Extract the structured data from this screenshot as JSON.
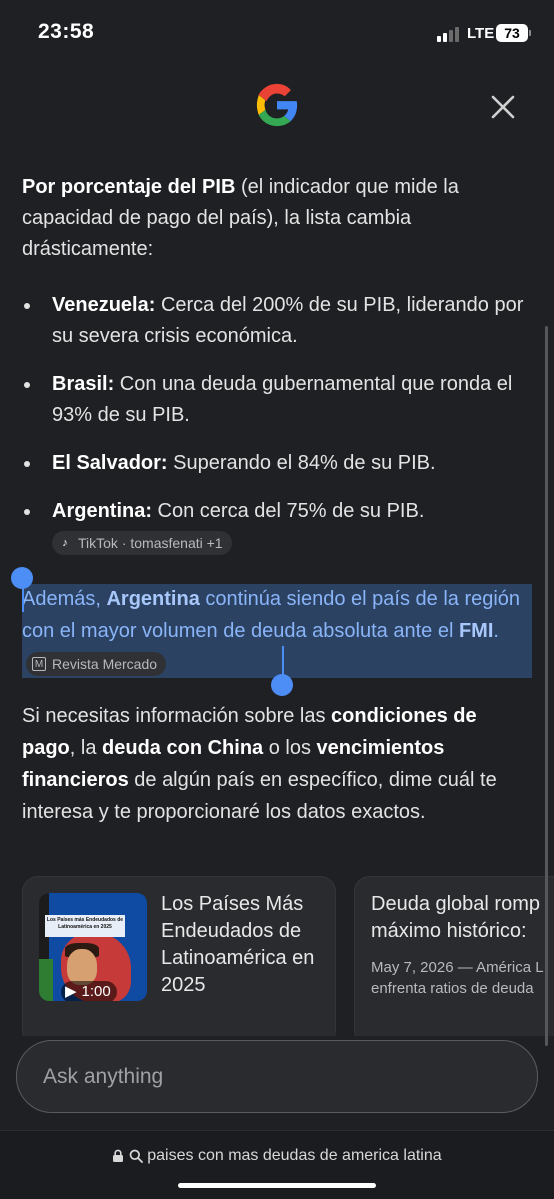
{
  "status": {
    "time": "23:58",
    "network": "LTE",
    "battery": "73"
  },
  "header": {
    "logo": "google-g-logo",
    "close_icon": "close-icon"
  },
  "intro": {
    "bold": "Por porcentaje del PIB",
    "rest": " (el indicador que mide la capacidad de pago del país), la lista cambia drásticamente:"
  },
  "bullets": [
    {
      "country": "Venezuela:",
      "text": " Cerca del 200% de su PIB, liderando por su severa crisis económica."
    },
    {
      "country": "Brasil:",
      "text": " Con una deuda gubernamental que ronda el 93% de su PIB."
    },
    {
      "country": "El Salvador:",
      "text": " Superando el 84% de su PIB."
    },
    {
      "country": "Argentina:",
      "text": " Con cerca del 75% de su PIB."
    }
  ],
  "source_chip_1": {
    "label": "TikTok · tomasfenati +1",
    "icon": "tiktok-icon"
  },
  "highlighted": {
    "t1": "Además, ",
    "b1": "Argentina",
    "t2": " continúa siendo el país de la región con el mayor volumen de deuda absoluta ante el ",
    "b2": "FMI",
    "t3": ".",
    "chip": "Revista Mercado",
    "chip_icon": "M"
  },
  "para3": {
    "t1": "Si necesitas información sobre las ",
    "b1": "condiciones de pago",
    "t2": ", la ",
    "b2": "deuda con China",
    "t3": " o los ",
    "b3": "vencimientos financieros",
    "t4": " de algún país en específico, dime cuál te interesa y te proporcionaré los datos exactos."
  },
  "cards": [
    {
      "title": "Los Países Más Endeudados de Latinoamérica en 2025",
      "duration": "1:00",
      "thumb_banner": "Los Países más Endeudados de Latinoamérica en 2025"
    },
    {
      "title": "Deuda global romp",
      "title_line2": "máximo histórico:",
      "meta_line1": "May 7, 2026 — América L",
      "meta_line2": "enfrenta ratios de deuda"
    }
  ],
  "ask": {
    "placeholder": "Ask anything"
  },
  "url_bar": {
    "query": "paises con mas deudas de america latina"
  },
  "colors": {
    "background": "#1f2024",
    "selection": "#2b4263",
    "handle": "#4c8df6",
    "link": "#8ab4f8"
  }
}
